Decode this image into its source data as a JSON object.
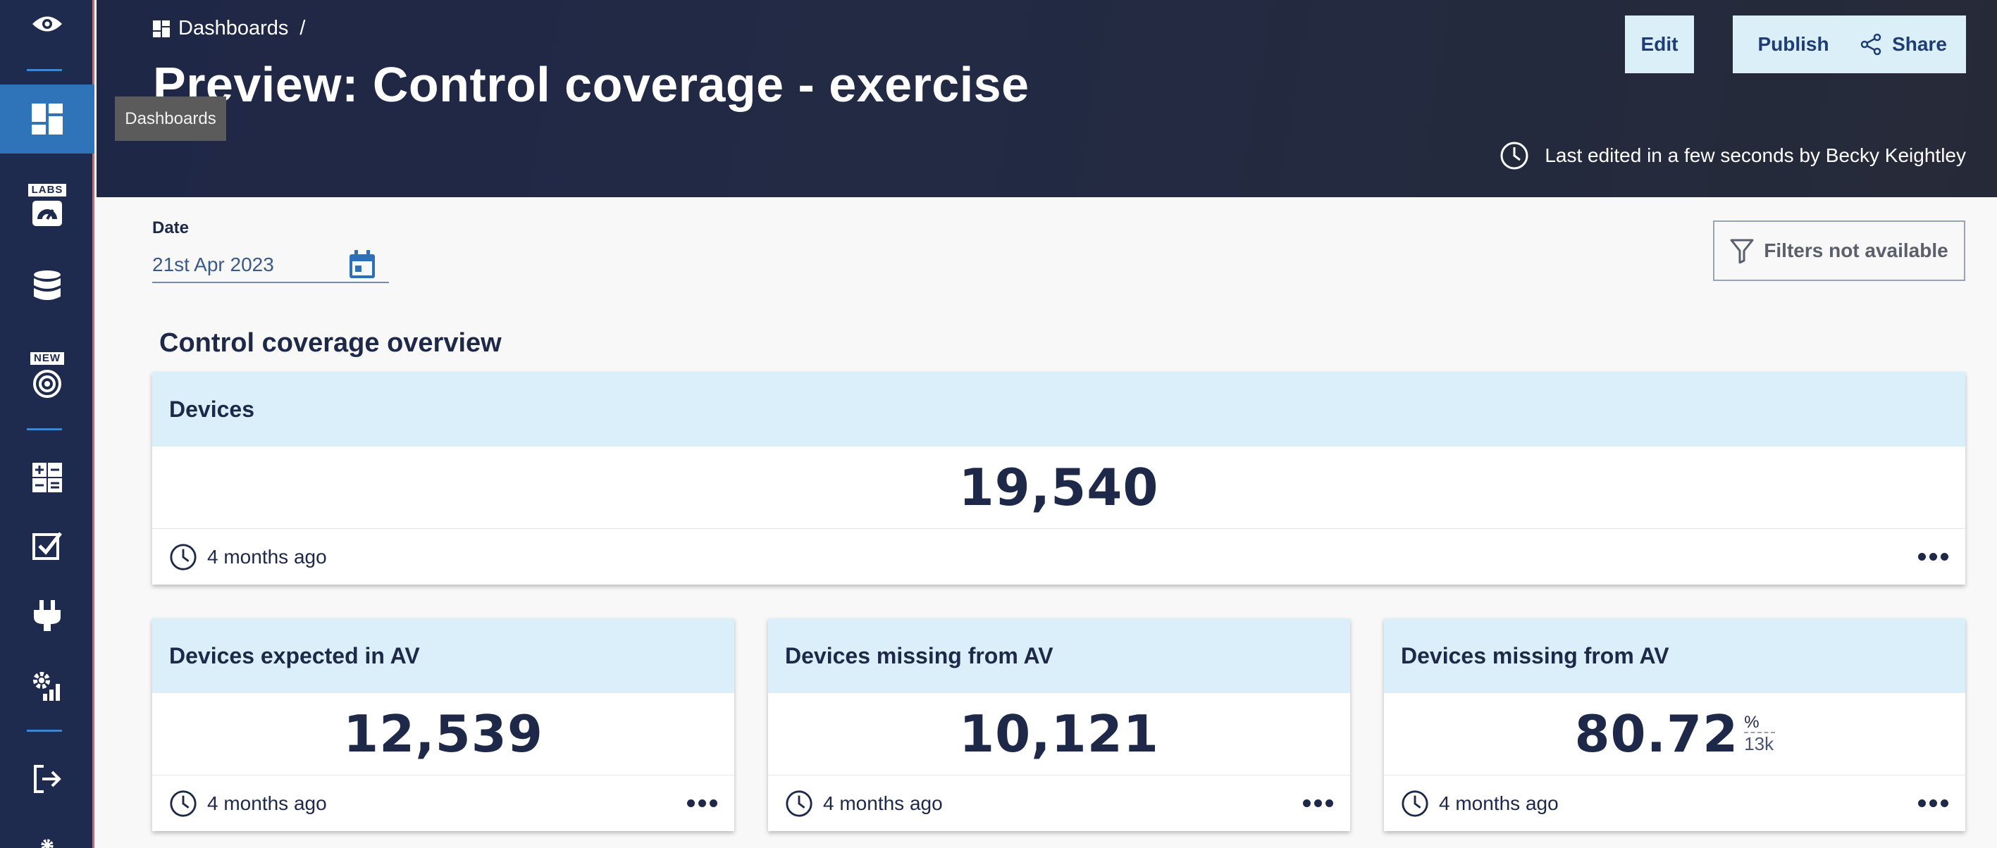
{
  "sidebar": {
    "tooltip": "Dashboards",
    "badges": {
      "labs": "LABS",
      "new": "NEW"
    }
  },
  "header": {
    "breadcrumb": "Dashboards",
    "breadcrumb_sep": "/",
    "title": "Preview: Control coverage - exercise",
    "buttons": {
      "edit": "Edit",
      "publish": "Publish",
      "share": "Share"
    },
    "last_edited": "Last edited in a few seconds by Becky Keightley"
  },
  "filters": {
    "date_label": "Date",
    "date_value": "21st Apr 2023",
    "filters_button": "Filters not available"
  },
  "section": {
    "title": "Control coverage overview"
  },
  "cards": [
    {
      "title": "Devices",
      "value": "19,540",
      "updated": "4 months ago"
    },
    {
      "title": "Devices expected in AV",
      "value": "12,539",
      "updated": "4 months ago"
    },
    {
      "title": "Devices missing from AV",
      "value": "10,121",
      "updated": "4 months ago"
    },
    {
      "title": "Devices missing from AV",
      "value": "80.72",
      "unit": "%",
      "denominator": "13k",
      "updated": "4 months ago"
    }
  ],
  "colors": {
    "sidebar_bg": "#1f2b4e",
    "sidebar_active": "#2f73b8",
    "header_bg": "#222a44",
    "card_head_bg": "#dbeffa",
    "button_bg": "#dbeff9",
    "text_dark": "#1e2848"
  },
  "icons": [
    "eye-icon",
    "dashboard-icon",
    "gauge-icon",
    "database-icon",
    "target-icon",
    "calculator-icon",
    "checkbox-icon",
    "plug-icon",
    "settings-chart-icon",
    "logout-icon",
    "gear-icon",
    "clock-icon",
    "calendar-icon",
    "filter-icon",
    "share-icon",
    "more-icon"
  ]
}
